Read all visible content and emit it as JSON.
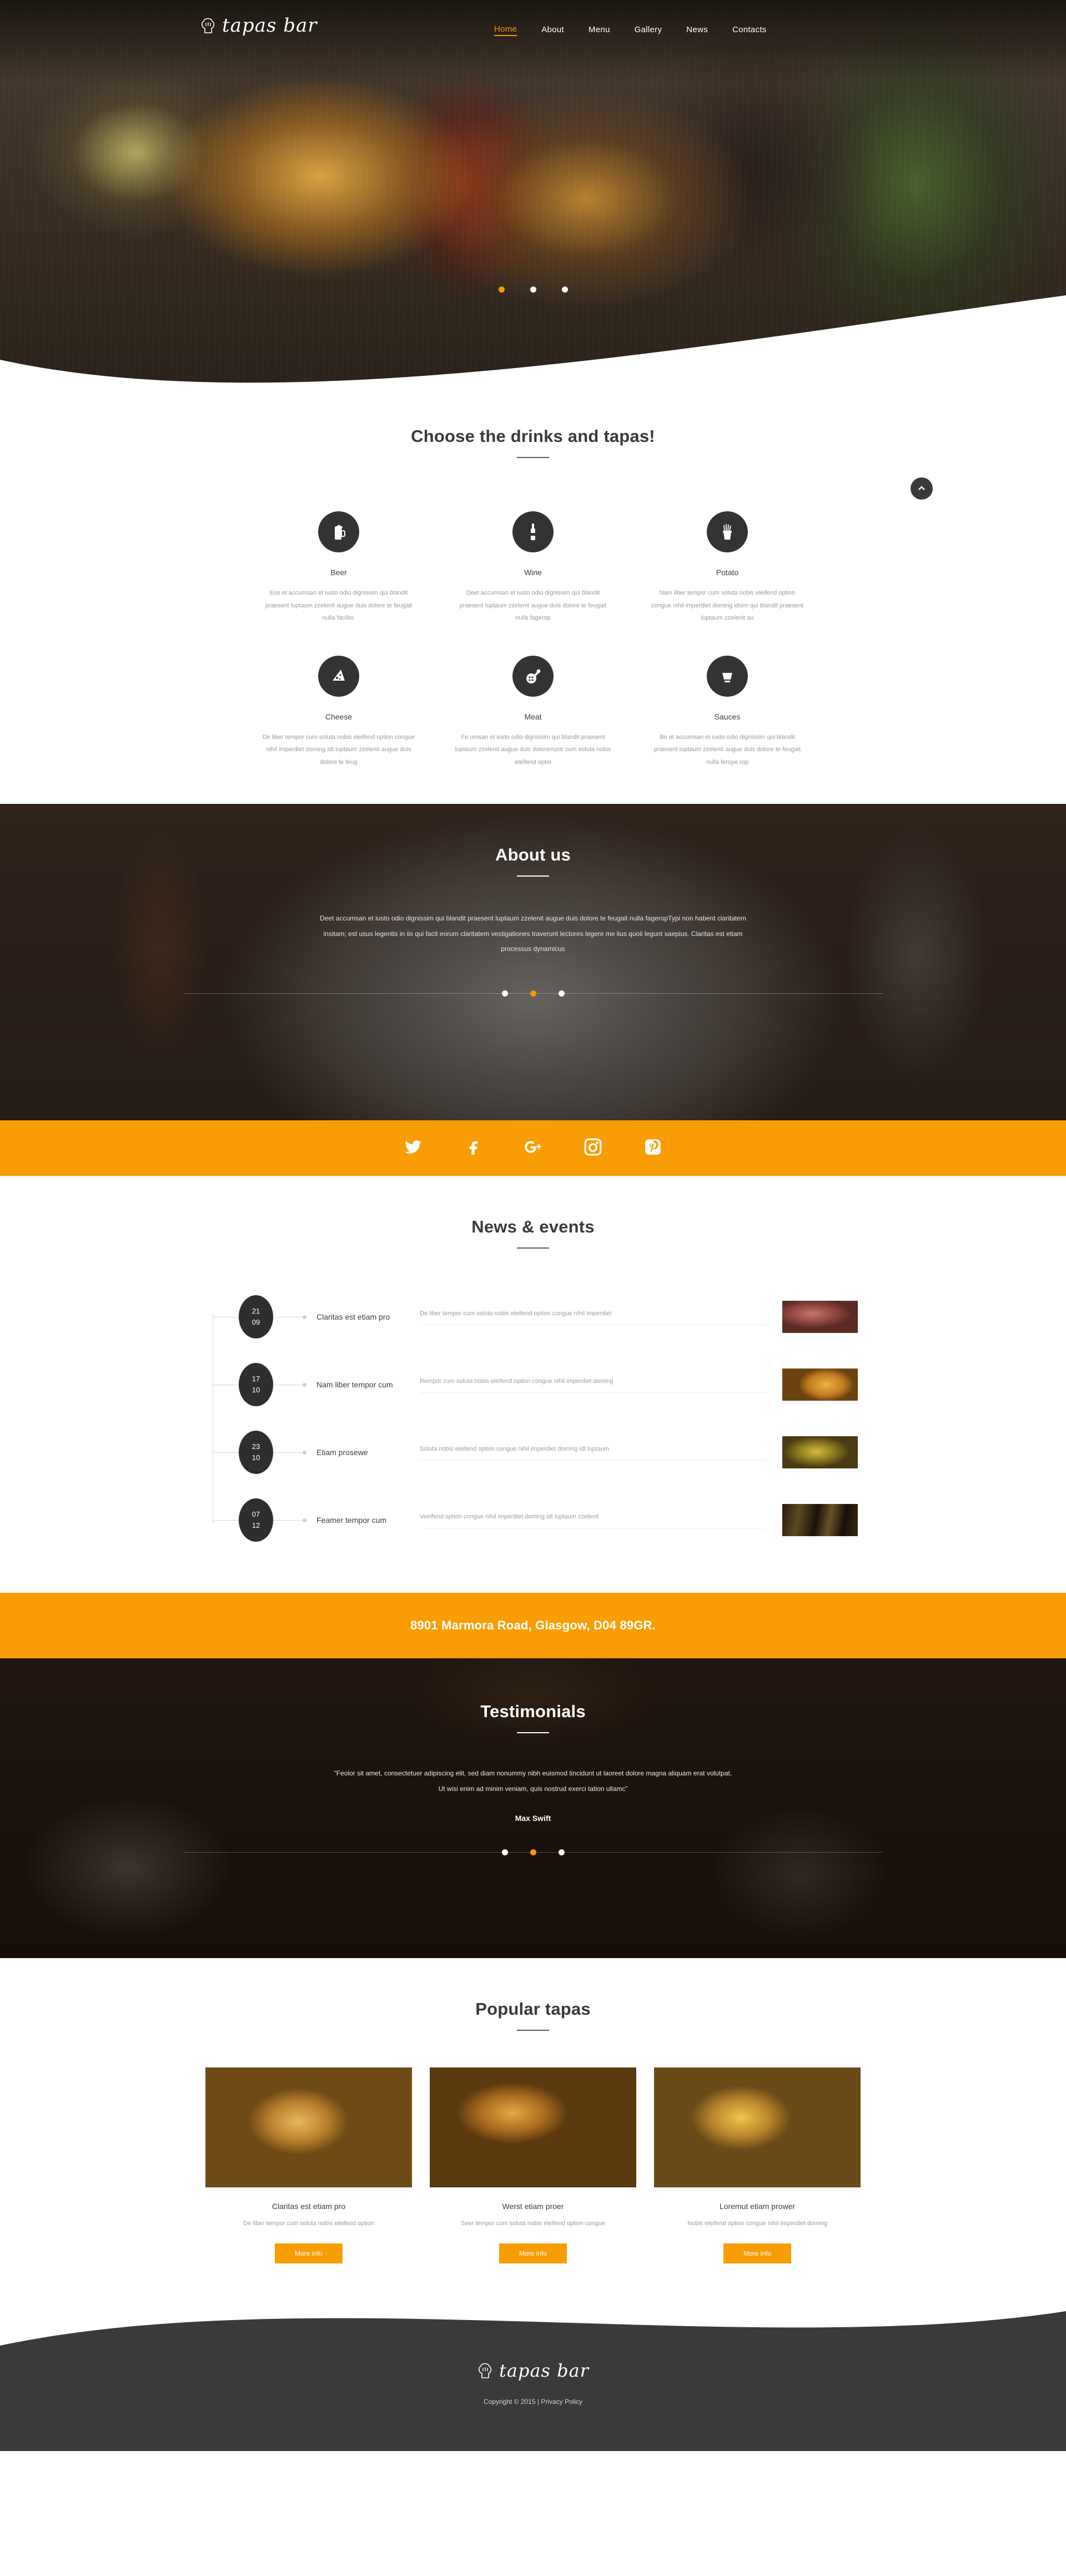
{
  "brand": {
    "name": "tapas bar",
    "icon": "chef-hat-icon"
  },
  "nav": {
    "items": [
      {
        "label": "Home",
        "active": true
      },
      {
        "label": "About",
        "active": false
      },
      {
        "label": "Menu",
        "active": false
      },
      {
        "label": "Gallery",
        "active": false
      },
      {
        "label": "News",
        "active": false
      },
      {
        "label": "Contacts",
        "active": false
      }
    ]
  },
  "hero": {
    "slider_dots": 3,
    "active_dot": 1
  },
  "services": {
    "title": "Choose the drinks and tapas!",
    "scroll_top_icon": "chevron-up-icon",
    "items": [
      {
        "icon": "beer-mug-icon",
        "name": "Beer",
        "desc": "Eos et accumsan et iusto odio dignissim qui blandit praesent luptaum zzelenit augue duis dolore te feugait nulla facilisi."
      },
      {
        "icon": "wine-bottle-icon",
        "name": "Wine",
        "desc": "Deet accumsan et iusto odio dignissim qui blandit praesent luptaum zzelenit augue duis dolore te feugait nulla fagerop"
      },
      {
        "icon": "fries-icon",
        "name": "Potato",
        "desc": "Nam liber tempor cum soluta nobis eleifend option congue nihil imperdiet doming idsim qui blandit praesent luptaum zzelenit au"
      },
      {
        "icon": "cheese-icon",
        "name": "Cheese",
        "desc": "De liber tempor cum soluta nobis eleifend option congue nihil imperdiet doming idt luptaum zzelenit augue duis dolore te feug"
      },
      {
        "icon": "meat-leg-icon",
        "name": "Meat",
        "desc": "Fe umsan et iusto odio dignissim qui blandit praesent luptaum zzelenit augue duis dolorempor cum soluta nobis eleifend optio"
      },
      {
        "icon": "sauce-bowl-icon",
        "name": "Sauces",
        "desc": "Bo et accumsan et iusto odio dignissim qui blandit praesent luptaum zzelenit augue duis dolore te feugait nulla ferope rop"
      }
    ]
  },
  "about": {
    "title": "About us",
    "text": "Deet accumsan et iusto odio dignissim qui blandit praesent luptaum zzelenit augue duis dolore te feugait nulla fageropTypi non habent claritatem insitam; est usus legentis in iis qui facit eorum claritatem vestigationes traverunt lectores legere me lius quoii legunt saepius. Claritas est etiam processus dynamicus",
    "slider_dots": 3,
    "active_dot": 2
  },
  "social": {
    "items": [
      {
        "icon": "twitter-icon",
        "label": "Twitter"
      },
      {
        "icon": "facebook-icon",
        "label": "Facebook"
      },
      {
        "icon": "google-plus-icon",
        "label": "Google Plus"
      },
      {
        "icon": "instagram-icon",
        "label": "Instagram"
      },
      {
        "icon": "pinterest-icon",
        "label": "Pinterest"
      }
    ]
  },
  "news": {
    "title": "News & events",
    "items": [
      {
        "day": "21",
        "month": "09",
        "title": "Claritas est etiam pro",
        "summary": "De liber tempor cum soluta nobis eleifend option congue nihil imperdiet",
        "thumb": "th-steak"
      },
      {
        "day": "17",
        "month": "10",
        "title": "Nam liber tempor cum",
        "summary": "Rempor cum soluta nobis eleifend option congue nihil imperdiet doming",
        "thumb": "th-soup"
      },
      {
        "day": "23",
        "month": "10",
        "title": "Etiam prosewe",
        "summary": "Soluta nobis eleifend option congue nihil imperdiet doming idt luptaum",
        "thumb": "th-veg"
      },
      {
        "day": "07",
        "month": "12",
        "title": "Feamer tempor cum",
        "summary": "Veeifend option congue nihil imperdiet doming idt luptaum zzelenit",
        "thumb": "th-wine"
      }
    ]
  },
  "address": {
    "text": "8901 Marmora Road, Glasgow, D04 89GR."
  },
  "testimonials": {
    "title": "Testimonials",
    "quote": "“Feolor sit amet, consectetuer adipiscing elit, sed diam nonummy nibh euismod tincidunt ut laoreet dolore magna aliquam erat volutpat. Ut wisi enim ad minim veniam, quis nostrud exerci tation ullamc”",
    "author": "Max Swift",
    "slider_dots": 3,
    "active_dot": 2
  },
  "popular": {
    "title": "Popular tapas",
    "items": [
      {
        "image": "pi-samosa",
        "title": "Claritas est etiam pro",
        "desc": "De liber tempor cum soluta nobis eleifend option",
        "button": "More info"
      },
      {
        "image": "pi-skewer",
        "title": "Werst etiam proer",
        "desc": "Seer tempor cum soluta nobis eleifend option congue",
        "button": "More info"
      },
      {
        "image": "pi-taco",
        "title": "Loremut etiam prower",
        "desc": "Nobis eleifend option congue nihil imperdiet doming",
        "button": "More info"
      }
    ]
  },
  "footer": {
    "brand": "tapas bar",
    "copyright": "Copyright © 2015 | ",
    "privacy": "Privacy Policy"
  },
  "colors": {
    "accent": "#f99d05",
    "dark": "#333333",
    "muted": "#9d9d9d"
  }
}
